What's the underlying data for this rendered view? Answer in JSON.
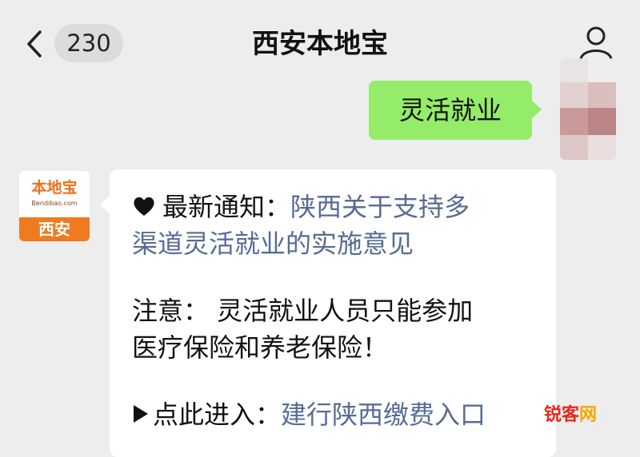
{
  "header": {
    "back_icon": "chevron-left-icon",
    "unread_count": "230",
    "title": "西安本地宝",
    "profile_icon": "person-icon"
  },
  "messages": {
    "outgoing": {
      "text": "灵活就业",
      "bubble_color": "#95ec69"
    },
    "incoming": {
      "sender_avatar": {
        "logo_text": "本地宝",
        "logo_sub": "Bendibao.com",
        "city_label": "西安",
        "brand_color": "#f07a1f"
      },
      "notice_icon": "heart-icon",
      "notice_label": "最新通知：",
      "notice_link_line1": "陕西关于支持多",
      "notice_link_line2": "渠道灵活就业的实施意见",
      "note_line1": "注意： 灵活就业人员只能参加",
      "note_line2": "医疗保险和养老保险！",
      "entry_icon": "play-icon",
      "entry_label": "点此进入：",
      "entry_link": "建行陕西缴费入口",
      "link_color": "#576b95"
    }
  },
  "watermark": {
    "text_a": "锐客",
    "text_b": "网"
  }
}
